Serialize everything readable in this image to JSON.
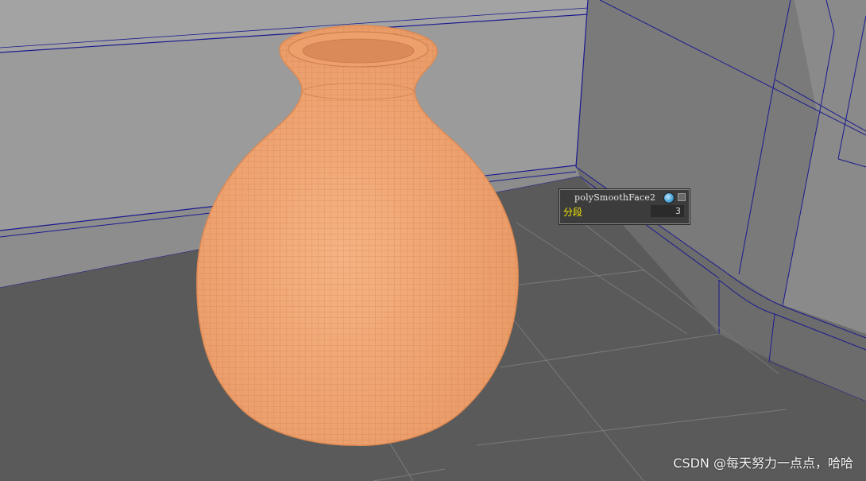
{
  "node_hud": {
    "title": "polySmoothFace2",
    "globe_icon": "globe-icon",
    "close_icon": "close-icon",
    "attribute_label": "分段",
    "attribute_value": "3"
  },
  "watermark": "CSDN @每天努力一点点，哈哈",
  "colors": {
    "floor": "#5b5b5b",
    "wall": "#9a9a9a",
    "wireframe_edges": "#1a1a90",
    "vase_fill": "#f3a672",
    "vase_wire": "#c87a48",
    "hud_label": "#f2e600"
  }
}
